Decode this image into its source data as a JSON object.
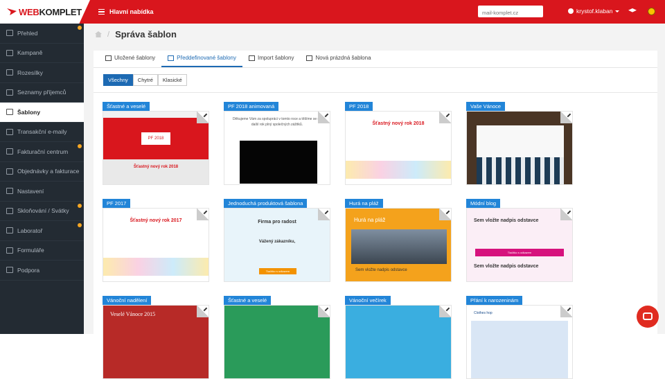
{
  "app": {
    "logo_a": "WEB",
    "logo_b": "KOMPLET",
    "menu": "Hlavní nabídka",
    "search_placeholder": "mail-komplet.cz",
    "user": "krystof.klaban"
  },
  "colors": {
    "brand": "#d9161d",
    "accent": "#2285d8",
    "sidebar": "#232b33"
  },
  "sidebar": [
    {
      "label": "Přehled",
      "dot": true
    },
    {
      "label": "Kampaně",
      "dot": false
    },
    {
      "label": "Rozesílky",
      "dot": false
    },
    {
      "label": "Seznamy příjemců",
      "dot": false
    },
    {
      "label": "Šablony",
      "active": true,
      "dot": false
    },
    {
      "label": "Transakční e-maily",
      "dot": false
    },
    {
      "label": "Fakturační centrum",
      "dot": true
    },
    {
      "label": "Objednávky a fakturace",
      "dot": false
    },
    {
      "label": "Nastavení",
      "dot": false
    },
    {
      "label": "Skloňování / Svátky",
      "dot": true
    },
    {
      "label": "Laboratoř",
      "dot": true
    },
    {
      "label": "Formuláře",
      "dot": false
    },
    {
      "label": "Podpora",
      "dot": false
    }
  ],
  "page": {
    "title": "Správa šablon"
  },
  "tabs": [
    {
      "label": "Uložené šablony",
      "icon": "save-icon"
    },
    {
      "label": "Předdefinované šablony",
      "icon": "grid-icon",
      "active": true
    },
    {
      "label": "Import šablony",
      "icon": "upload-icon"
    },
    {
      "label": "Nová prázdná šablona",
      "icon": "plus-icon"
    }
  ],
  "filters": [
    {
      "label": "Všechny",
      "on": true
    },
    {
      "label": "Chytré"
    },
    {
      "label": "Klasické"
    }
  ],
  "templates": [
    {
      "name": "Šťastné a veselé",
      "text": "Šťastný nový rok 2018",
      "sub": "PF 2018"
    },
    {
      "name": "PF 2018 animovaná",
      "text": "Děkujeme Vám za spolupráci v tomto roce a těšíme se na další rok plný společných zážitků."
    },
    {
      "name": "PF 2018",
      "text": "Šťastný nový rok 2018"
    },
    {
      "name": "Vaše Vánoce"
    },
    {
      "name": "PF 2017",
      "text": "Šťastný nový rok 2017"
    },
    {
      "name": "Jednoduchá produktová šablona",
      "text": "Firma pro radost",
      "sub": "Vážený zákazníku,",
      "btn": "Tlačítko s odkazem"
    },
    {
      "name": "Hurá na pláž",
      "text": "Hurá na pláž",
      "sub": "Sem vložte nadpis odstavce"
    },
    {
      "name": "Módní blog",
      "text": "Sem vložte nadpis odstavce",
      "sub": "Sem vložte nadpis odstavce",
      "btn": "Tlačítko s odkazem"
    },
    {
      "name": "Vánoční nadělení",
      "text": "Veselé Vánoce 2015"
    },
    {
      "name": "Šťastné a veselé"
    },
    {
      "name": "Vánoční večírek"
    },
    {
      "name": "Přání k narozeninám",
      "text": "Clothes hop"
    }
  ]
}
